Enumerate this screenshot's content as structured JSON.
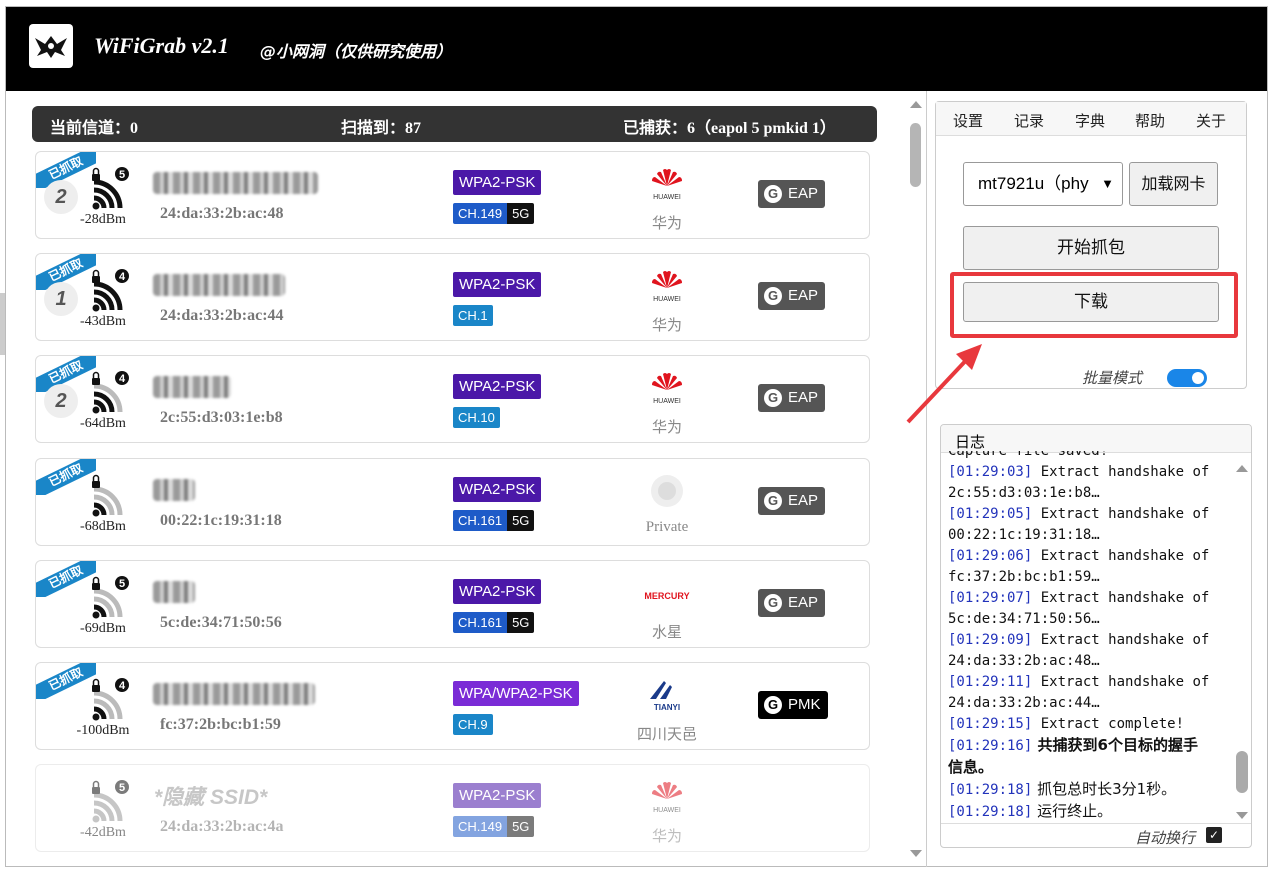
{
  "app": {
    "title": "WiFiGrab v2.1",
    "subtitle": "@小网洞（仅供研究使用）"
  },
  "status": {
    "channel": "当前信道：0",
    "scanned": "扫描到：87",
    "captured": "已捕获：6（eapol 5  pmkid 1）"
  },
  "captured_label": "已抓取",
  "networks": [
    {
      "clients": "2",
      "lock_count": "5",
      "signal_level": 3,
      "dbm": "-28dBm",
      "mac": "24:da:33:2b:ac:48",
      "auth": "WPA2-PSK",
      "channel": "CH.149",
      "band": "5G",
      "vendor": "华为",
      "vendor_logo": "HUAWEI",
      "tag": "EAP"
    },
    {
      "clients": "1",
      "lock_count": "4",
      "signal_level": 3,
      "dbm": "-43dBm",
      "mac": "24:da:33:2b:ac:44",
      "auth": "WPA2-PSK",
      "channel": "CH.1",
      "band": "",
      "vendor": "华为",
      "vendor_logo": "HUAWEI",
      "tag": "EAP"
    },
    {
      "clients": "2",
      "lock_count": "4",
      "signal_level": 2,
      "dbm": "-64dBm",
      "mac": "2c:55:d3:03:1e:b8",
      "auth": "WPA2-PSK",
      "channel": "CH.10",
      "band": "",
      "vendor": "华为",
      "vendor_logo": "HUAWEI",
      "tag": "EAP"
    },
    {
      "clients": "",
      "lock_count": "",
      "signal_level": 1,
      "dbm": "-68dBm",
      "mac": "00:22:1c:19:31:18",
      "auth": "WPA2-PSK",
      "channel": "CH.161",
      "band": "5G",
      "vendor": "Private",
      "vendor_logo": "",
      "tag": "EAP"
    },
    {
      "clients": "",
      "lock_count": "5",
      "signal_level": 1,
      "dbm": "-69dBm",
      "mac": "5c:de:34:71:50:56",
      "auth": "WPA2-PSK",
      "channel": "CH.161",
      "band": "5G",
      "vendor": "水星",
      "vendor_logo": "MERCURY",
      "tag": "EAP"
    },
    {
      "clients": "",
      "lock_count": "4",
      "signal_level": 1,
      "dbm": "-100dBm",
      "mac": "fc:37:2b:bc:b1:59",
      "auth": "WPA/WPA2-PSK",
      "channel": "CH.9",
      "band": "",
      "vendor": "四川天邑",
      "vendor_logo": "TIANYI",
      "tag": "PMK"
    },
    {
      "clients": "",
      "lock_count": "5",
      "signal_level": 3,
      "dbm": "-42dBm",
      "mac": "24:da:33:2b:ac:4a",
      "auth": "WPA2-PSK",
      "channel": "CH.149",
      "band": "5G",
      "vendor": "华为",
      "vendor_logo": "HUAWEI",
      "tag": "",
      "ssid": "*隐藏 SSID*"
    }
  ],
  "menu": [
    "设置",
    "记录",
    "字典",
    "帮助",
    "关于"
  ],
  "adapter": {
    "selected": "mt7921u（phy",
    "load_button": "加载网卡"
  },
  "buttons": {
    "start": "开始抓包",
    "download": "下载"
  },
  "batch_mode": {
    "label": "批量模式",
    "on": true
  },
  "log": {
    "title": "日志",
    "lines": [
      {
        "ts": "",
        "text": "Capture file saved!"
      },
      {
        "ts": "[01:29:03]",
        "text": " Extract handshake of"
      },
      {
        "ts": "",
        "text": "2c:55:d3:03:1e:b8…"
      },
      {
        "ts": "[01:29:05]",
        "text": " Extract handshake of"
      },
      {
        "ts": "",
        "text": "00:22:1c:19:31:18…"
      },
      {
        "ts": "[01:29:06]",
        "text": " Extract handshake of"
      },
      {
        "ts": "",
        "text": "fc:37:2b:bc:b1:59…"
      },
      {
        "ts": "[01:29:07]",
        "text": " Extract handshake of"
      },
      {
        "ts": "",
        "text": "5c:de:34:71:50:56…"
      },
      {
        "ts": "[01:29:09]",
        "text": " Extract handshake of"
      },
      {
        "ts": "",
        "text": "24:da:33:2b:ac:48…"
      },
      {
        "ts": "[01:29:11]",
        "text": " Extract handshake of"
      },
      {
        "ts": "",
        "text": "24:da:33:2b:ac:44…"
      },
      {
        "ts": "[01:29:15]",
        "text": " Extract complete!"
      },
      {
        "ts": "[01:29:16]",
        "text": " 共捕获到6个目标的握手",
        "style": "bold"
      },
      {
        "ts": "",
        "text": "信息。",
        "style": "bold"
      },
      {
        "ts": "[01:29:18]",
        "text": " 抓包总时长3分1秒。",
        "style": "cn"
      },
      {
        "ts": "[01:29:18]",
        "text": " 运行终止。",
        "style": "cn"
      }
    ],
    "auto_wrap": {
      "label": "自动换行",
      "checked": true
    }
  },
  "colors": {
    "highlight": "#e8383d",
    "accent": "#1a86e8",
    "auth_badge": "#4b18a8"
  }
}
